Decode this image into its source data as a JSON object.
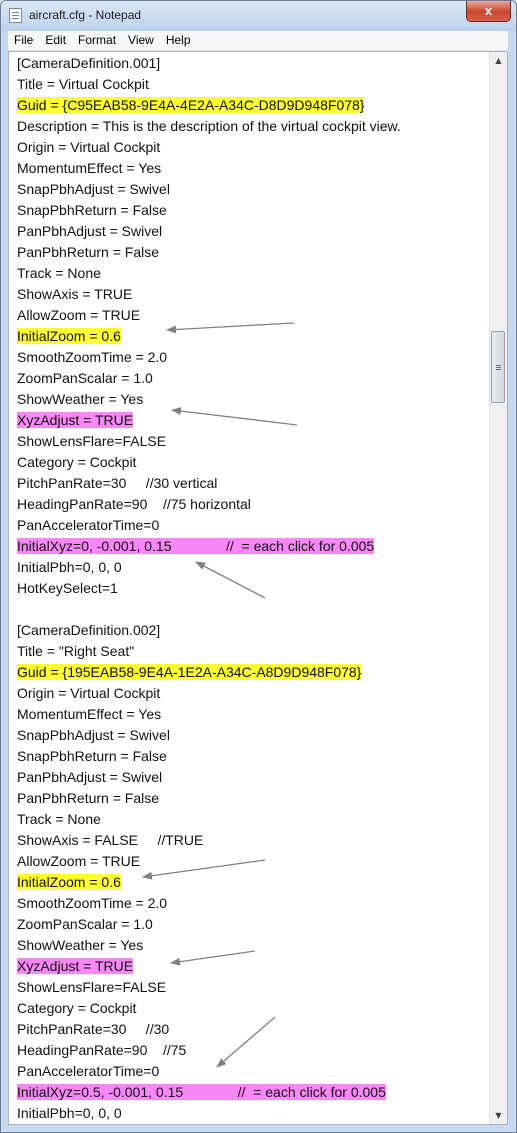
{
  "window": {
    "title": "aircraft.cfg - Notepad",
    "close_label": "x"
  },
  "menu": [
    "File",
    "Edit",
    "Format",
    "View",
    "Help"
  ],
  "icons": {
    "app": "notepad-icon",
    "close": "close-icon",
    "scroll_up": "scroll-up-arrow-icon",
    "scroll_down": "scroll-down-arrow-icon"
  },
  "colors": {
    "highlight_yellow": "#ffff33",
    "highlight_pink": "#f987f7",
    "arrow": "#808080"
  },
  "lines": [
    {
      "text": "[CameraDefinition.001]",
      "hl": ""
    },
    {
      "text": "Title = Virtual Cockpit",
      "hl": ""
    },
    {
      "text": "Guid = {C95EAB58-9E4A-4E2A-A34C-D8D9D948F078}",
      "hl": "yellow"
    },
    {
      "text": "Description = This is the description of the virtual cockpit view.",
      "hl": ""
    },
    {
      "text": "Origin = Virtual Cockpit",
      "hl": ""
    },
    {
      "text": "MomentumEffect = Yes",
      "hl": ""
    },
    {
      "text": "SnapPbhAdjust = Swivel",
      "hl": ""
    },
    {
      "text": "SnapPbhReturn = False",
      "hl": ""
    },
    {
      "text": "PanPbhAdjust = Swivel",
      "hl": ""
    },
    {
      "text": "PanPbhReturn = False",
      "hl": ""
    },
    {
      "text": "Track = None",
      "hl": ""
    },
    {
      "text": "ShowAxis = TRUE",
      "hl": ""
    },
    {
      "text": "AllowZoom = TRUE",
      "hl": ""
    },
    {
      "text": "InitialZoom = 0.6",
      "hl": "yellow"
    },
    {
      "text": "SmoothZoomTime = 2.0",
      "hl": ""
    },
    {
      "text": "ZoomPanScalar = 1.0",
      "hl": ""
    },
    {
      "text": "ShowWeather = Yes",
      "hl": ""
    },
    {
      "text": "XyzAdjust = TRUE",
      "hl": "pink"
    },
    {
      "text": "ShowLensFlare=FALSE",
      "hl": ""
    },
    {
      "text": "Category = Cockpit",
      "hl": ""
    },
    {
      "text": "PitchPanRate=30     //30 vertical",
      "hl": ""
    },
    {
      "text": "HeadingPanRate=90    //75 horizontal",
      "hl": ""
    },
    {
      "text": "PanAcceleratorTime=0",
      "hl": ""
    },
    {
      "text": "InitialXyz=0, -0.001, 0.15              //  = each click for 0.005",
      "hl": "pink"
    },
    {
      "text": "InitialPbh=0, 0, 0",
      "hl": ""
    },
    {
      "text": "HotKeySelect=1",
      "hl": ""
    },
    {
      "text": "",
      "hl": ""
    },
    {
      "text": "[CameraDefinition.002]",
      "hl": ""
    },
    {
      "text": "Title = \"Right Seat\"",
      "hl": ""
    },
    {
      "text": "Guid = {195EAB58-9E4A-1E2A-A34C-A8D9D948F078}",
      "hl": "yellow"
    },
    {
      "text": "Origin = Virtual Cockpit",
      "hl": ""
    },
    {
      "text": "MomentumEffect = Yes",
      "hl": ""
    },
    {
      "text": "SnapPbhAdjust = Swivel",
      "hl": ""
    },
    {
      "text": "SnapPbhReturn = False",
      "hl": ""
    },
    {
      "text": "PanPbhAdjust = Swivel",
      "hl": ""
    },
    {
      "text": "PanPbhReturn = False",
      "hl": ""
    },
    {
      "text": "Track = None",
      "hl": ""
    },
    {
      "text": "ShowAxis = FALSE     //TRUE",
      "hl": ""
    },
    {
      "text": "AllowZoom = TRUE",
      "hl": ""
    },
    {
      "text": "InitialZoom = 0.6",
      "hl": "yellow"
    },
    {
      "text": "SmoothZoomTime = 2.0",
      "hl": ""
    },
    {
      "text": "ZoomPanScalar = 1.0",
      "hl": ""
    },
    {
      "text": "ShowWeather = Yes",
      "hl": ""
    },
    {
      "text": "XyzAdjust = TRUE",
      "hl": "pink"
    },
    {
      "text": "ShowLensFlare=FALSE",
      "hl": ""
    },
    {
      "text": "Category = Cockpit",
      "hl": ""
    },
    {
      "text": "PitchPanRate=30     //30",
      "hl": ""
    },
    {
      "text": "HeadingPanRate=90    //75",
      "hl": ""
    },
    {
      "text": "PanAcceleratorTime=0",
      "hl": ""
    },
    {
      "text": "InitialXyz=0.5, -0.001, 0.15              //  = each click for 0.005",
      "hl": "pink"
    },
    {
      "text": "InitialPbh=0, 0, 0",
      "hl": ""
    }
  ]
}
